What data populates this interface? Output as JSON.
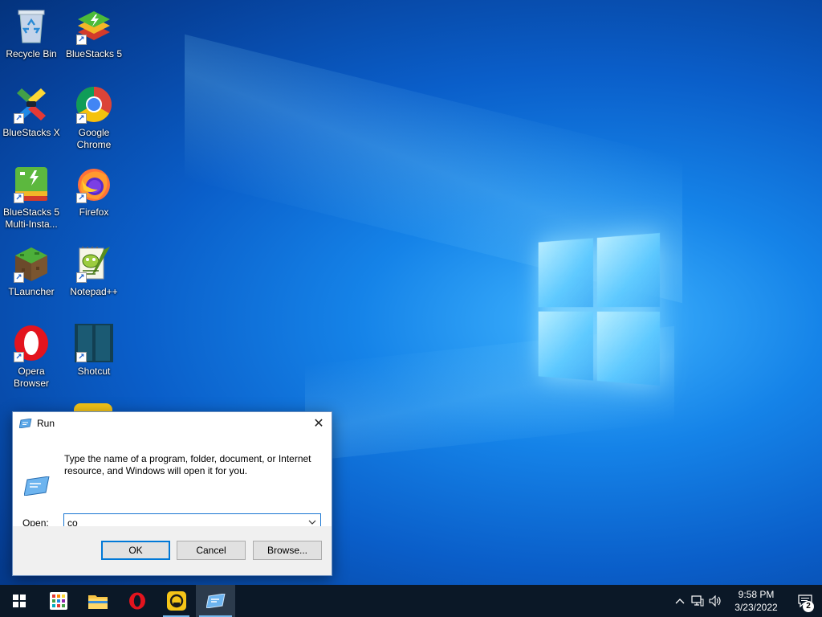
{
  "desktop": {
    "icons": [
      {
        "label": "Recycle Bin",
        "icon": "recycle-bin-icon"
      },
      {
        "label": "BlueStacks 5",
        "icon": "bluestacks5-icon"
      },
      {
        "label": "BlueStacks X",
        "icon": "bluestacksx-icon"
      },
      {
        "label": "Google Chrome",
        "icon": "chrome-icon"
      },
      {
        "label": "BlueStacks 5 Multi-Insta...",
        "icon": "bluestacks-multi-icon"
      },
      {
        "label": "Firefox",
        "icon": "firefox-icon"
      },
      {
        "label": "TLauncher",
        "icon": "tlauncher-icon"
      },
      {
        "label": "Notepad++",
        "icon": "notepadpp-icon"
      },
      {
        "label": "Opera Browser",
        "icon": "opera-icon"
      },
      {
        "label": "Shotcut",
        "icon": "shotcut-icon"
      }
    ]
  },
  "run_dialog": {
    "title": "Run",
    "close_glyph": "✕",
    "description": "Type the name of a program, folder, document, or Internet resource, and Windows will open it for you.",
    "open_label_prefix": "",
    "open_label_accel": "O",
    "open_label_rest": "pen:",
    "open_value": "co",
    "ok_label": "OK",
    "cancel_label": "Cancel",
    "browse_label": "Browse..."
  },
  "taskbar": {
    "apps": [
      {
        "name": "start",
        "icon": "windows-start-icon"
      },
      {
        "name": "app-grid",
        "icon": "app-grid-icon"
      },
      {
        "name": "file-explorer",
        "icon": "file-explorer-icon"
      },
      {
        "name": "opera",
        "icon": "opera-icon"
      },
      {
        "name": "app-yellow",
        "icon": "yellow-app-icon"
      },
      {
        "name": "run",
        "icon": "run-icon"
      }
    ],
    "tray": {
      "time": "9:58 PM",
      "date": "3/23/2022",
      "notification_count": "2"
    }
  },
  "colors": {
    "taskbar_bg": "#0b1827",
    "accent": "#0078d7",
    "desktop_blue": "#0a5ec9"
  }
}
